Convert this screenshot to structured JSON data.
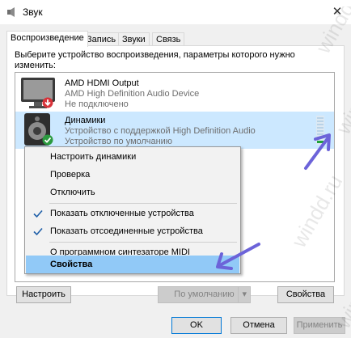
{
  "window": {
    "title": "Звук",
    "close_glyph": "✕"
  },
  "tabs": [
    {
      "label": "Воспроизведение",
      "active": true
    },
    {
      "label": "Запись",
      "active": false
    },
    {
      "label": "Звуки",
      "active": false
    },
    {
      "label": "Связь",
      "active": false
    }
  ],
  "instruction": "Выберите устройство воспроизведения, параметры которого нужно изменить:",
  "devices": [
    {
      "name": "AMD HDMI Output",
      "description": "AMD High Definition Audio Device",
      "status": "Не подключено",
      "icon": "monitor-speaker-icon",
      "badge": "disconnected-arrow-icon",
      "selected": false
    },
    {
      "name": "Динамики",
      "description": "Устройство с поддержкой High Definition Audio",
      "status": "Устройство по умолчанию",
      "icon": "speaker-icon",
      "badge": "default-check-icon",
      "selected": true
    }
  ],
  "context_menu": {
    "items": [
      {
        "label": "Настроить динамики",
        "checked": false
      },
      {
        "label": "Проверка",
        "checked": false
      },
      {
        "label": "Отключить",
        "checked": false
      },
      {
        "label": "Показать отключенные устройства",
        "checked": true
      },
      {
        "label": "Показать отсоединенные устройства",
        "checked": true
      },
      {
        "label": "О программном синтезаторе MIDI",
        "checked": false
      },
      {
        "label": "Свойства",
        "checked": false,
        "highlighted": true
      }
    ]
  },
  "buttons": {
    "configure": "Настроить",
    "set_default": "По умолчанию",
    "properties": "Свойства",
    "ok": "OK",
    "cancel": "Отмена",
    "apply": "Применить"
  },
  "watermark": "windd.ru",
  "colors": {
    "accent": "#0078d7",
    "selection": "#cce8ff",
    "menu_highlight": "#91c9f7",
    "annotation_arrow": "#6c63d9"
  }
}
